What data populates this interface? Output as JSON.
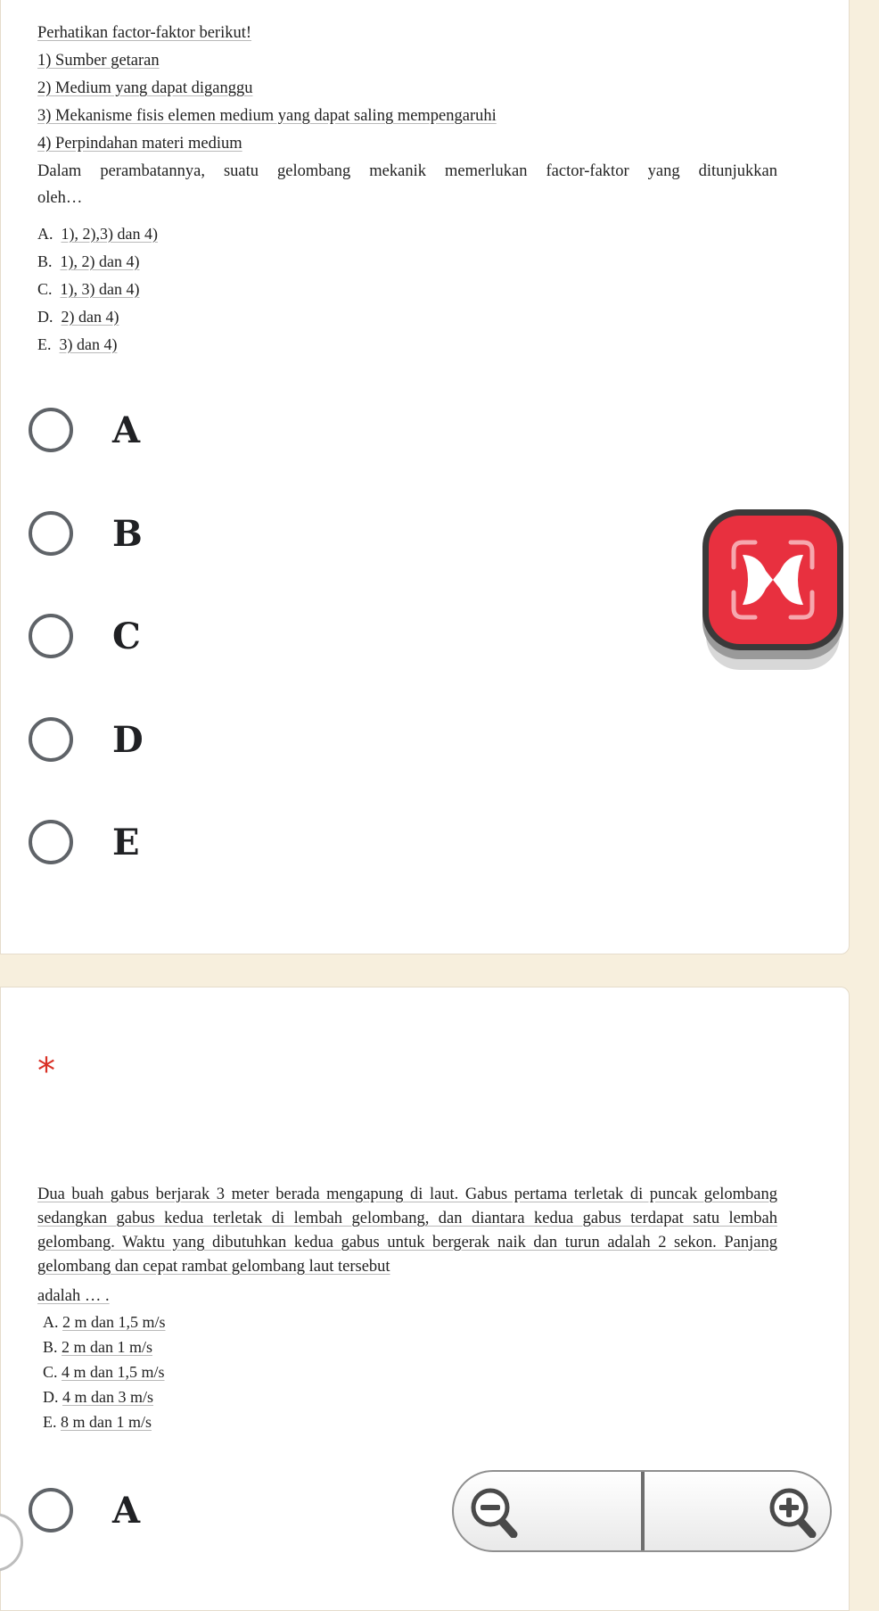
{
  "question1": {
    "intro": "Perhatikan factor-faktor berikut!",
    "factors": [
      "1)   Sumber getaran",
      "2)   Medium yang dapat diganggu",
      "3)   Mekanisme fisis elemen medium yang dapat saling mempengaruhi",
      "4)   Perpindahan materi medium"
    ],
    "prompt_line1": "Dalam perambatannya, suatu gelombang mekanik memerlukan factor-faktor yang ditunjukkan",
    "prompt_line2": "oleh…",
    "options": [
      {
        "letter": "A.",
        "text": "1), 2),3) dan 4)"
      },
      {
        "letter": "B.",
        "text": "1), 2) dan 4)"
      },
      {
        "letter": "C.",
        "text": "1), 3) dan 4)"
      },
      {
        "letter": "D.",
        "text": "2) dan 4)"
      },
      {
        "letter": "E.",
        "text": "3) dan 4)"
      }
    ],
    "choices": [
      "A",
      "B",
      "C",
      "D",
      "E"
    ]
  },
  "question2": {
    "required_marker": "*",
    "statement": "Dua buah gabus berjarak 3 meter berada mengapung di laut. Gabus pertama terletak di puncak gelombang sedangkan gabus kedua terletak di lembah gelombang, dan diantara kedua gabus terdapat satu lembah gelombang. Waktu yang dibutuhkan kedua gabus untuk bergerak naik dan turun adalah 2 sekon. Panjang gelombang dan cepat rambat gelombang laut tersebut",
    "statement_end": "adalah … .",
    "options": [
      {
        "letter": "A.",
        "text": "2 m dan 1,5 m/s"
      },
      {
        "letter": "B.",
        "text": "2 m dan 1 m/s"
      },
      {
        "letter": "C.",
        "text": "4 m dan 1,5 m/s"
      },
      {
        "letter": "D.",
        "text": "4 m dan 3 m/s"
      },
      {
        "letter": "E.",
        "text": "8 m dan 1 m/s"
      }
    ],
    "choices": [
      "A"
    ]
  },
  "overlay": {
    "close_icon": "x-close-icon",
    "zoom_out_icon": "zoom-out-icon",
    "zoom_in_icon": "zoom-in-icon",
    "accent": "#e8303f"
  }
}
